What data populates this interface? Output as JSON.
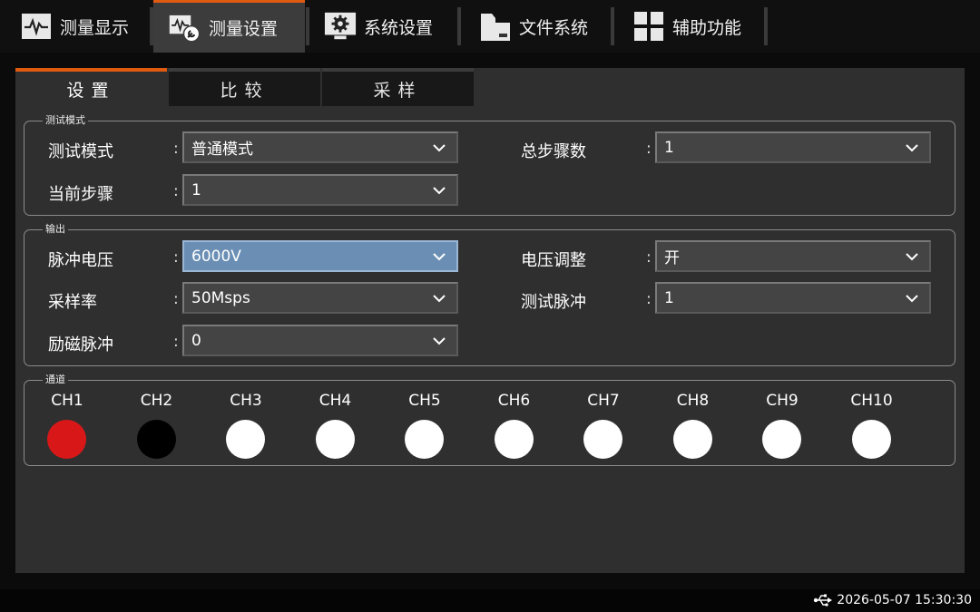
{
  "nav": {
    "tabs": [
      {
        "label": "测量显示",
        "icon": "waveform-icon"
      },
      {
        "label": "测量设置",
        "icon": "waveform-wrench-icon"
      },
      {
        "label": "系统设置",
        "icon": "gear-monitor-icon"
      },
      {
        "label": "文件系统",
        "icon": "folder-icon"
      },
      {
        "label": "辅助功能",
        "icon": "grid-icon"
      }
    ],
    "active_index": 1
  },
  "subtabs": [
    {
      "label": "设置"
    },
    {
      "label": "比较"
    },
    {
      "label": "采样"
    }
  ],
  "groups": {
    "test_mode": {
      "title": "测试模式",
      "test_mode": {
        "label": "测试模式",
        "value": "普通模式"
      },
      "total_steps": {
        "label": "总步骤数",
        "value": "1"
      },
      "current_step": {
        "label": "当前步骤",
        "value": "1"
      }
    },
    "output": {
      "title": "输出",
      "pulse_voltage": {
        "label": "脉冲电压",
        "value": "6000V"
      },
      "voltage_adjust": {
        "label": "电压调整",
        "value": "开"
      },
      "sample_rate": {
        "label": "采样率",
        "value": "50Msps"
      },
      "test_pulse": {
        "label": "测试脉冲",
        "value": "1"
      },
      "excite_pulse": {
        "label": "励磁脉冲",
        "value": "0"
      }
    },
    "channels": {
      "title": "通道",
      "items": [
        {
          "label": "CH1",
          "color": "#d81818"
        },
        {
          "label": "CH2",
          "color": "#000000"
        },
        {
          "label": "CH3",
          "color": "#ffffff"
        },
        {
          "label": "CH4",
          "color": "#ffffff"
        },
        {
          "label": "CH5",
          "color": "#ffffff"
        },
        {
          "label": "CH6",
          "color": "#ffffff"
        },
        {
          "label": "CH7",
          "color": "#ffffff"
        },
        {
          "label": "CH8",
          "color": "#ffffff"
        },
        {
          "label": "CH9",
          "color": "#ffffff"
        },
        {
          "label": "CH10",
          "color": "#ffffff"
        }
      ]
    }
  },
  "status": {
    "datetime": "2026-05-07 15:30:30",
    "usb_icon": "usb-icon"
  },
  "colors": {
    "accent": "#e05a10",
    "focus": "#6b8fb4",
    "panel": "#2f2f2f"
  },
  "colon": ":"
}
